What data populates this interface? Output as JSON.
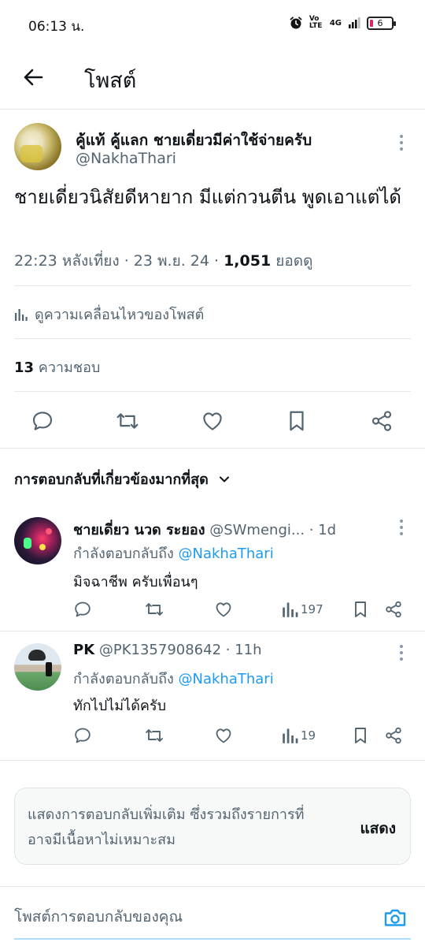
{
  "status_bar": {
    "time": "06:13 น.",
    "network_label": "4G",
    "volte_label": "Vo LTE",
    "battery": "6"
  },
  "header": {
    "title": "โพสต์",
    "back_icon": "arrow-left-icon"
  },
  "main_post": {
    "author_name": "คู้แท้ คู้แลก ชายเดี่ยวมีค่าใช้จ่ายครับ",
    "author_handle": "@NakhaThari",
    "text": "ชายเดี่ยวนิสัยดีหายาก มีแต่กวนตีน พูดเอาแต่ได้",
    "time": "22:23 หลังเที่ยง · 23 พ.ย. 24 · ",
    "views_count": "1,051",
    "views_label": " ยอดดู",
    "analytics_label": "ดูความเคลื่อนไหวของโพสต์",
    "likes_count": "13",
    "likes_label": " ความชอบ",
    "actions": [
      "reply-icon",
      "repost-icon",
      "like-icon",
      "bookmark-icon",
      "share-icon"
    ]
  },
  "replies_sort_label": "การตอบกลับที่เกี่ยวข้องมากที่สุด",
  "replies": [
    {
      "name": "ชายเดี่ยว นวด ระยอง",
      "handle": " @SWmengi...",
      "time": " · 1d",
      "replying_prefix": "กำลังตอบกลับถึง ",
      "replying_to": "@NakhaThari",
      "text": "มิจฉาชีพ ครับเพื่อนๆ",
      "views": "197"
    },
    {
      "name": "PK",
      "handle": " @PK1357908642",
      "time": " · 11h",
      "replying_prefix": "กำลังตอบกลับถึง ",
      "replying_to": "@NakhaThari",
      "text": "ทักไปไม่ได้ครับ",
      "views": "19"
    }
  ],
  "show_more": {
    "text": "แสดงการตอบกลับเพิ่มเติม ซึ่งรวมถึงรายการที่อาจมีเนื้อหาไม่เหมาะสม",
    "button": "แสดง"
  },
  "composer": {
    "placeholder": "โพสต์การตอบกลับของคุณ",
    "camera_icon": "camera-icon"
  },
  "colors": {
    "accent": "#1d9bf0",
    "text_primary": "#0f1419",
    "text_secondary": "#536471",
    "divider": "#e6e9ec"
  }
}
